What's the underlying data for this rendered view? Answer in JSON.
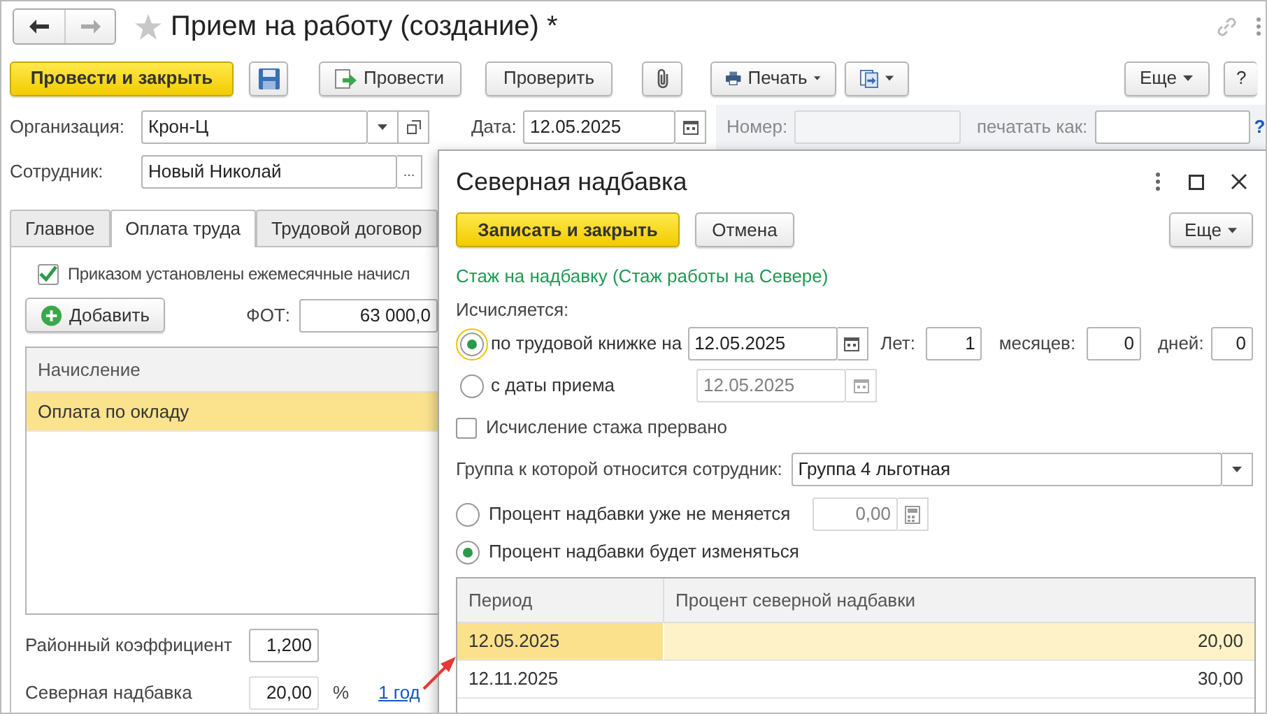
{
  "window": {
    "title": "Прием на работу (создание) *"
  },
  "toolbar": {
    "post_close": "Провести и закрыть",
    "post": "Провести",
    "check": "Проверить",
    "print": "Печать",
    "more": "Еще",
    "help": "?"
  },
  "organization": {
    "label": "Организация:",
    "value": "Крон-Ц"
  },
  "date": {
    "label": "Дата:",
    "value": "12.05.2025"
  },
  "number": {
    "label": "Номер:"
  },
  "print_as": {
    "label": "печатать как:",
    "help": "?"
  },
  "employee": {
    "label": "Сотрудник:",
    "value": "Новый Николай",
    "select": "..."
  },
  "tabs": [
    {
      "label": "Главное",
      "selected": false
    },
    {
      "label": "Оплата труда",
      "selected": true
    },
    {
      "label": "Трудовой договор",
      "selected": false
    }
  ],
  "monthly": {
    "label": "Приказом установлены ежемесячные начисл",
    "checked": true
  },
  "add_button": "Добавить",
  "fot": {
    "label": "ФОТ:",
    "value": "63 000,0"
  },
  "accruals": {
    "columns": [
      "Начисление"
    ],
    "rows": [
      {
        "name": "Оплата по окладу",
        "selected": true
      }
    ]
  },
  "district_coef": {
    "label": "Районный коэффициент",
    "value": "1,200"
  },
  "north_bonus": {
    "label": "Северная надбавка",
    "value": "20,00",
    "unit": "%",
    "link": "1 год"
  },
  "dialog": {
    "title": "Северная надбавка",
    "save_close": "Записать и закрыть",
    "cancel": "Отмена",
    "more": "Еще",
    "section": "Стаж на надбавку (Стаж работы на Севере)",
    "calc_label": "Исчисляется:",
    "options": [
      {
        "label": "по трудовой книжке на",
        "selected": true,
        "focused": true,
        "date": "12.05.2025",
        "disabled": false
      },
      {
        "label": "с даты приема",
        "selected": false,
        "focused": false,
        "date": "12.05.2025",
        "disabled": true
      }
    ],
    "years": {
      "label": "Лет:",
      "value": "1"
    },
    "months": {
      "label": "месяцев:",
      "value": "0"
    },
    "days": {
      "label": "дней:",
      "value": "0"
    },
    "interrupted": {
      "label": "Исчисление стажа прервано",
      "checked": false
    },
    "group": {
      "label": "Группа к которой относится сотрудник:",
      "value": "Группа 4 льготная"
    },
    "modes": [
      {
        "label": "Процент надбавки уже не меняется",
        "selected": false
      },
      {
        "label": "Процент надбавки будет изменяться",
        "selected": true
      }
    ],
    "fixed_value": {
      "value": "0,00",
      "disabled": true
    },
    "table": {
      "columns": [
        "Период",
        "Процент северной надбавки"
      ],
      "rows": [
        {
          "period": "12.05.2025",
          "percent": "20,00",
          "selected": true
        },
        {
          "period": "12.11.2025",
          "percent": "30,00",
          "selected": false
        }
      ]
    }
  }
}
